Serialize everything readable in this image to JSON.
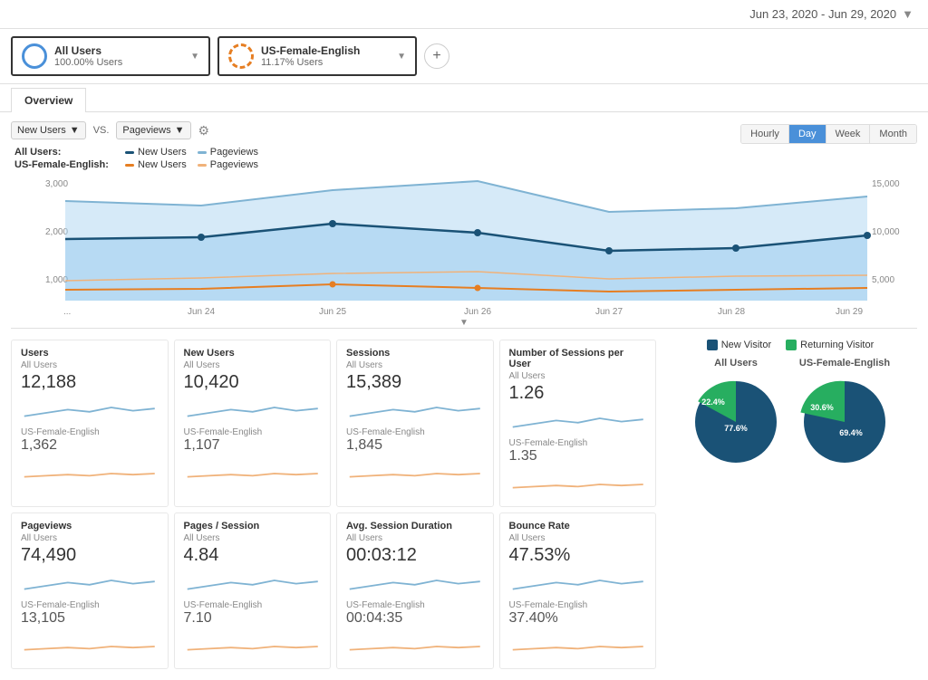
{
  "header": {
    "date_range": "Jun 23, 2020 - Jun 29, 2020"
  },
  "segments": [
    {
      "name": "All Users",
      "pct": "100.00% Users",
      "icon_type": "solid"
    },
    {
      "name": "US-Female-English",
      "pct": "11.17% Users",
      "icon_type": "dashed"
    }
  ],
  "add_segment_label": "+",
  "tabs": [
    {
      "label": "Overview",
      "active": true
    }
  ],
  "chart_controls": {
    "metric1_label": "New Users",
    "vs_label": "VS.",
    "metric2_label": "Pageviews",
    "time_buttons": [
      "Hourly",
      "Day",
      "Week",
      "Month"
    ],
    "active_time": "Day"
  },
  "legend": {
    "all_users_label": "All Users:",
    "segment_label": "US-Female-English:",
    "new_users": "New Users",
    "pageviews": "Pageviews"
  },
  "chart_x_labels": [
    "...",
    "Jun 24",
    "Jun 25",
    "Jun 26",
    "Jun 27",
    "Jun 28",
    "Jun 29"
  ],
  "chart_y_labels_left": [
    "3,000",
    "2,000",
    "1,000"
  ],
  "chart_y_labels_right": [
    "15,000",
    "10,000",
    "5,000"
  ],
  "metrics": [
    {
      "title": "Users",
      "all_users_label": "All Users",
      "all_users_value": "12,188",
      "segment_label": "US-Female-English",
      "segment_value": "1,362"
    },
    {
      "title": "New Users",
      "all_users_label": "All Users",
      "all_users_value": "10,420",
      "segment_label": "US-Female-English",
      "segment_value": "1,107"
    },
    {
      "title": "Sessions",
      "all_users_label": "All Users",
      "all_users_value": "15,389",
      "segment_label": "US-Female-English",
      "segment_value": "1,845"
    },
    {
      "title": "Number of Sessions per User",
      "all_users_label": "All Users",
      "all_users_value": "1.26",
      "segment_label": "US-Female-English",
      "segment_value": "1.35"
    },
    {
      "title": "Pageviews",
      "all_users_label": "All Users",
      "all_users_value": "74,490",
      "segment_label": "US-Female-English",
      "segment_value": "13,105"
    },
    {
      "title": "Pages / Session",
      "all_users_label": "All Users",
      "all_users_value": "4.84",
      "segment_label": "US-Female-English",
      "segment_value": "7.10"
    },
    {
      "title": "Avg. Session Duration",
      "all_users_label": "All Users",
      "all_users_value": "00:03:12",
      "segment_label": "US-Female-English",
      "segment_value": "00:04:35"
    },
    {
      "title": "Bounce Rate",
      "all_users_label": "All Users",
      "all_users_value": "47.53%",
      "segment_label": "US-Female-English",
      "segment_value": "37.40%"
    }
  ],
  "pie_section": {
    "legend_items": [
      "New Visitor",
      "Returning Visitor"
    ],
    "all_users_label": "All Users",
    "segment_label": "US-Female-English",
    "all_users_pie": {
      "new_visitor_pct": 77.6,
      "returning_visitor_pct": 22.4,
      "new_visitor_label": "77.6%",
      "returning_visitor_label": "22.4%"
    },
    "segment_pie": {
      "new_visitor_pct": 69.4,
      "returning_visitor_pct": 30.6,
      "new_visitor_label": "69.4%",
      "returning_visitor_label": "30.6%"
    }
  }
}
